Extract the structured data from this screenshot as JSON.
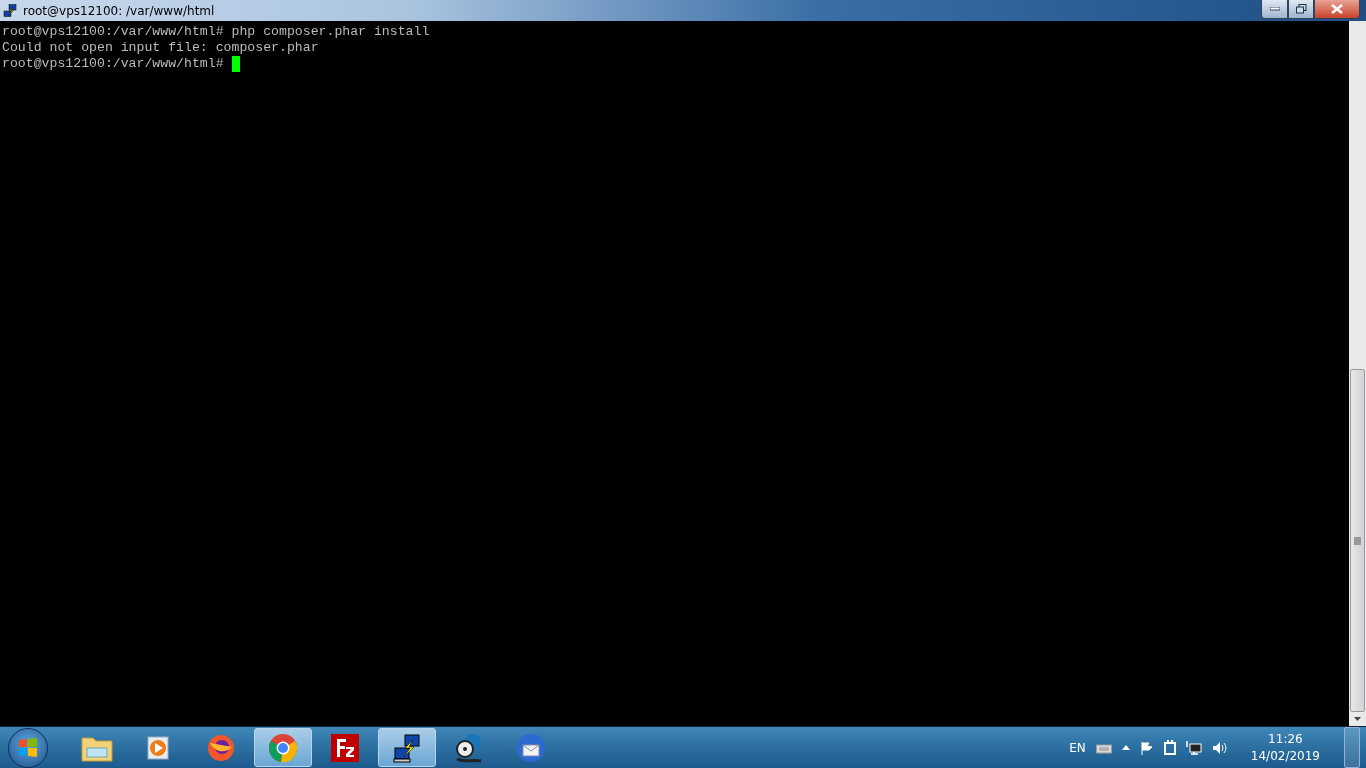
{
  "window": {
    "title": "root@vps12100: /var/www/html"
  },
  "terminal": {
    "lines": [
      "root@vps12100:/var/www/html# php composer.phar install",
      "Could not open input file: composer.phar",
      "root@vps12100:/var/www/html#"
    ],
    "cursor_visible": true
  },
  "taskbar": {
    "apps": [
      {
        "kind": "folder",
        "active": false
      },
      {
        "kind": "player",
        "active": false
      },
      {
        "kind": "firefox",
        "active": false
      },
      {
        "kind": "chrome",
        "active": true
      },
      {
        "kind": "filezilla",
        "active": false
      },
      {
        "kind": "putty",
        "active": true
      },
      {
        "kind": "film",
        "active": false
      },
      {
        "kind": "mail",
        "active": false
      }
    ],
    "language": "EN",
    "time": "11:26",
    "date": "14/02/2019"
  }
}
